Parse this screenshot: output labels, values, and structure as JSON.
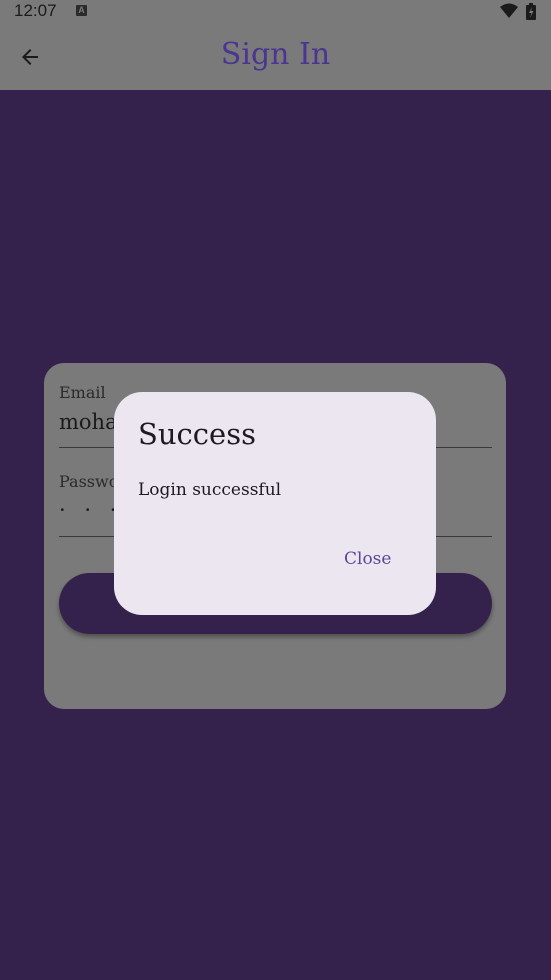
{
  "status_bar": {
    "time": "12:07",
    "notification_icon": "a-icon",
    "wifi_icon": "wifi-icon",
    "battery_icon": "battery-icon"
  },
  "app_bar": {
    "back_icon": "back-arrow-icon",
    "title": "Sign In"
  },
  "form": {
    "email_label": "Email",
    "email_value": "moha",
    "password_label": "Passwo",
    "password_value": "· · ·"
  },
  "dialog": {
    "title": "Success",
    "message": "Login successful",
    "close_label": "Close"
  },
  "colors": {
    "background": "#34224c",
    "scrim_gray": "#7a7a7a",
    "accent": "#5c4696",
    "dialog_surface": "#ece6f1"
  }
}
